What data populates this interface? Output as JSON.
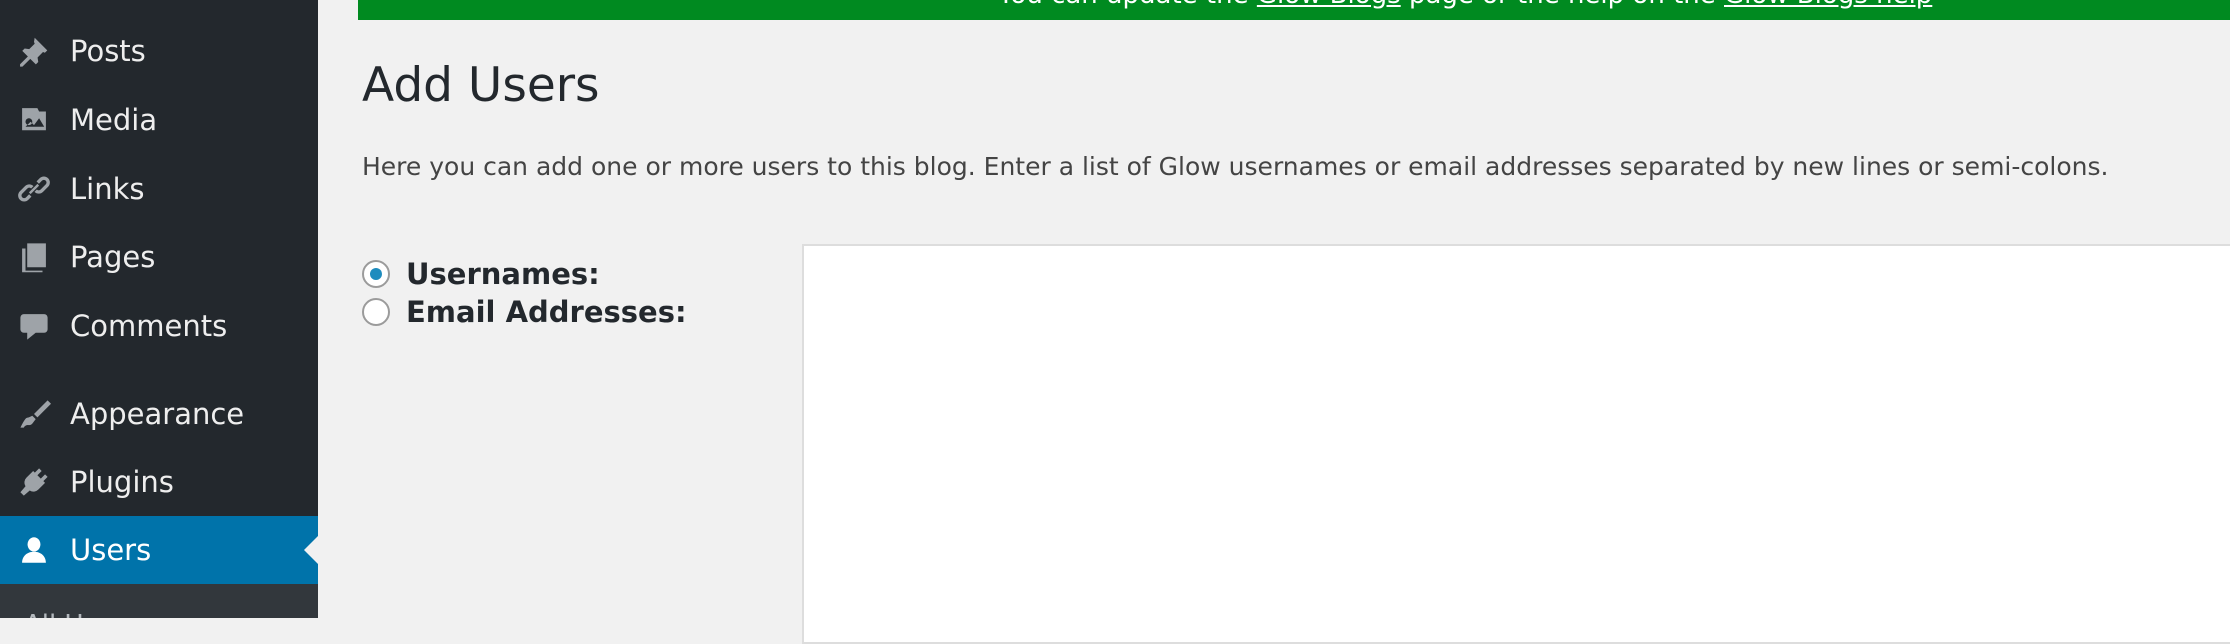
{
  "sidebar": {
    "items": [
      {
        "label": "Posts",
        "icon": "pushpin-icon"
      },
      {
        "label": "Media",
        "icon": "media-icon"
      },
      {
        "label": "Links",
        "icon": "link-icon"
      },
      {
        "label": "Pages",
        "icon": "pages-icon"
      },
      {
        "label": "Comments",
        "icon": "comment-icon"
      },
      {
        "label": "Appearance",
        "icon": "paintbrush-icon"
      },
      {
        "label": "Plugins",
        "icon": "plug-icon"
      },
      {
        "label": "Users",
        "icon": "user-icon",
        "active": true
      }
    ],
    "submenu_first": "All Users"
  },
  "notice": {
    "text_before": "You can update the ",
    "link1": "Glow Blogs",
    "text_middle": " page or the help on the ",
    "link2": "Glow Blogs help"
  },
  "main": {
    "title": "Add Users",
    "description": "Here you can add one or more users to this blog. Enter a list of Glow usernames or email addresses separated by new lines or semi-colons.",
    "options": [
      {
        "label": "Usernames:",
        "checked": true
      },
      {
        "label": "Email Addresses:",
        "checked": false
      }
    ]
  },
  "colors": {
    "sidebar_bg": "#23282d",
    "active_bg": "#0073aa",
    "notice_bg": "#008a20",
    "page_bg": "#f1f1f1",
    "radio_dot": "#1e8cbe"
  }
}
